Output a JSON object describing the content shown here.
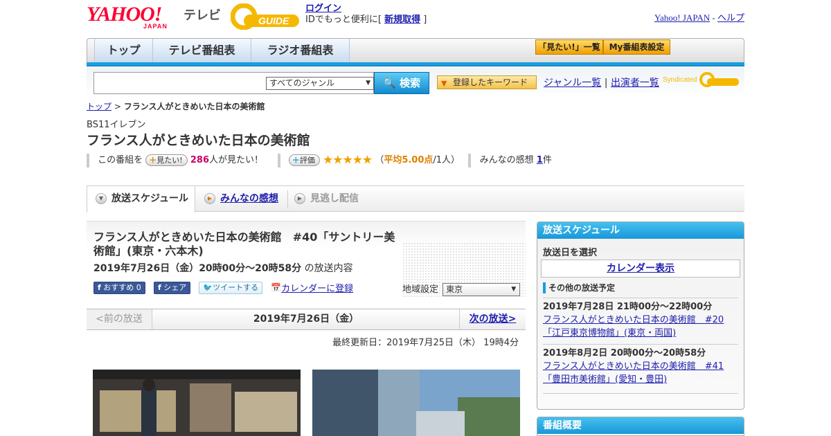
{
  "header": {
    "logo_text": "YAHOO!",
    "logo_sub": "JAPAN",
    "service_name": "テレビ",
    "gguide_logo": "G-GUIDE",
    "login_link": "ログイン",
    "id_text_prefix": "IDでもっと便利に[",
    "signup_link": "新規取得",
    "id_text_suffix": "]",
    "yahoo_japan_link": "Yahoo! JAPAN",
    "separator": "-",
    "help_link": "ヘルプ"
  },
  "nav": {
    "tabs": [
      "トップ",
      "テレビ番組表",
      "ラジオ番組表"
    ],
    "mitai_list": "「見たい!」一覧",
    "my_schedule": "My番組表設定"
  },
  "search": {
    "genre_selected": "すべてのジャンル",
    "search_button": "検索",
    "keyword_button": "登録したキーワード",
    "genre_list_link": "ジャンル一覧",
    "link_separator": "|",
    "performer_list_link": "出演者一覧",
    "syndicated_label": "Syndicated"
  },
  "breadcrumb": {
    "home": "トップ",
    "sep": ">",
    "current": "フランス人がときめいた日本の美術館"
  },
  "program": {
    "channel": "BS11イレブン",
    "title": "フランス人がときめいた日本の美術館",
    "this_program_label": "この番組を",
    "mitai_button": "見たい!",
    "mitai_count": "286",
    "mitai_suffix": "人が見たい！",
    "rating_button": "評価",
    "stars": "★★★★★",
    "avg_open": "（",
    "avg_text": "平均5.00点",
    "avg_people": "/1人）",
    "comments_label": "みんなの感想",
    "comments_count": "1",
    "comments_suffix": "件"
  },
  "tabs": {
    "schedule": "放送スケジュール",
    "comments": "みんなの感想",
    "missed": "見逃し配信"
  },
  "episode": {
    "title": "フランス人がときめいた日本の美術館　#40「サントリー美術館」(東京・六本木)",
    "airtime": "2019年7月26日（金）20時00分～20時58分",
    "airtime_suffix": "の放送内容",
    "recommend_button": "おすすめ 0",
    "share_button": "シェア",
    "tweet_button": "ツイートする",
    "calendar_link": "カレンダーに登録",
    "region_label": "地域設定",
    "region_value": "東京"
  },
  "pager": {
    "prev": "<前の放送",
    "current": "2019年7月26日（金）",
    "next": "次の放送>"
  },
  "last_updated": "最終更新日：2019年7月25日（木） 19時4分",
  "sidebar": {
    "header": "放送スケジュール",
    "pick_date": "放送日を選択",
    "calendar_button": "カレンダー表示",
    "other_label": "その他の放送予定",
    "items": [
      {
        "when": "2019年7月28日 21時00分～22時00分",
        "title": "フランス人がときめいた日本の美術館　#20「江戸東京博物館」(東京・両国)"
      },
      {
        "when": "2019年8月2日 20時00分～20時58分",
        "title": "フランス人がときめいた日本の美術館　#41「豊田市美術館」(愛知・豊田)"
      }
    ],
    "overview_header": "番組概要"
  },
  "colors": {
    "accent_blue": "#1a9de0",
    "link": "#1d1dae",
    "yahoo_red": "#ff0033",
    "star": "#f0a000",
    "mitai_pink": "#cc0066"
  }
}
